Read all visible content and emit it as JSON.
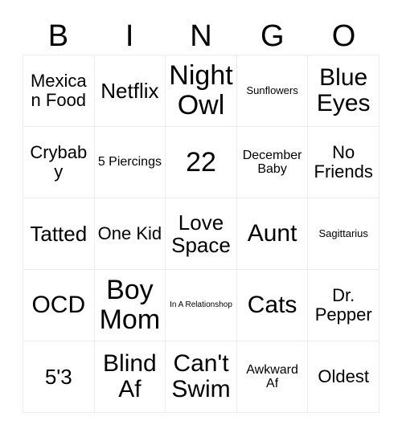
{
  "card": {
    "title": "BINGO",
    "header_letters": [
      "B",
      "I",
      "N",
      "G",
      "O"
    ],
    "colors": {
      "background": "#ffffff",
      "border": "#ececec",
      "text": "#000000"
    },
    "grid_size": "5x5",
    "rows": [
      [
        {
          "text": "Mexican Food",
          "size": "m"
        },
        {
          "text": "Netflix",
          "size": "l"
        },
        {
          "text": "Night Owl",
          "size": "xxl"
        },
        {
          "text": "Sunflowers",
          "size": "xs"
        },
        {
          "text": "Blue Eyes",
          "size": "xl"
        }
      ],
      [
        {
          "text": "Crybaby",
          "size": "m"
        },
        {
          "text": "5 Piercings",
          "size": "s"
        },
        {
          "text": "22",
          "size": "xxl"
        },
        {
          "text": "December Baby",
          "size": "s"
        },
        {
          "text": "No Friends",
          "size": "m"
        }
      ],
      [
        {
          "text": "Tatted",
          "size": "l"
        },
        {
          "text": "One Kid",
          "size": "m"
        },
        {
          "text": "Love Space",
          "size": "l"
        },
        {
          "text": "Aunt",
          "size": "xl"
        },
        {
          "text": "Sagittarius",
          "size": "xs"
        }
      ],
      [
        {
          "text": "OCD",
          "size": "xl"
        },
        {
          "text": "Boy Mom",
          "size": "xxl"
        },
        {
          "text": "In A Relationshop",
          "size": "xxs"
        },
        {
          "text": "Cats",
          "size": "xl"
        },
        {
          "text": "Dr. Pepper",
          "size": "m"
        }
      ],
      [
        {
          "text": "5'3",
          "size": "l"
        },
        {
          "text": "Blind Af",
          "size": "xl"
        },
        {
          "text": "Can't Swim",
          "size": "xl"
        },
        {
          "text": "Awkward Af",
          "size": "s"
        },
        {
          "text": "Oldest",
          "size": "m"
        }
      ]
    ]
  }
}
